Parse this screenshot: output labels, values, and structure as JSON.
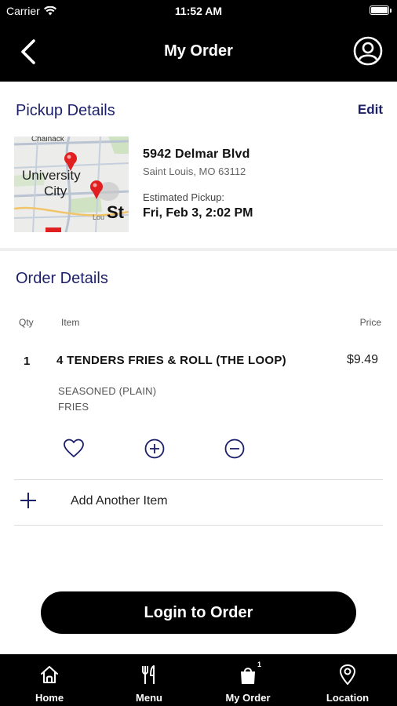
{
  "status_bar": {
    "carrier": "Carrier",
    "time": "11:52 AM"
  },
  "header": {
    "title": "My Order",
    "back_icon": "chevron-left-icon",
    "profile_icon": "user-circle-icon"
  },
  "pickup": {
    "title": "Pickup Details",
    "edit_label": "Edit",
    "map": {
      "labels": [
        "Chainack",
        "University",
        "City",
        "St",
        "Lou"
      ]
    },
    "street": "5942 Delmar Blvd",
    "city_line": "Saint Louis, MO 63112",
    "estimated_label": "Estimated Pickup:",
    "estimated_value": "Fri, Feb 3, 2:02 PM"
  },
  "order": {
    "title": "Order Details",
    "columns": {
      "qty": "Qty",
      "item": "Item",
      "price": "Price"
    },
    "items": [
      {
        "qty": "1",
        "name": "4 TENDERS FRIES & ROLL (THE LOOP)",
        "modifiers": [
          "SEASONED (PLAIN)",
          "FRIES"
        ],
        "price": "$9.49"
      }
    ],
    "actions": [
      "heart-icon",
      "plus-circle-icon",
      "minus-circle-icon"
    ],
    "add_item_label": "Add Another Item"
  },
  "login_button": "Login to Order",
  "tabs": [
    {
      "label": "Home",
      "icon": "home-icon"
    },
    {
      "label": "Menu",
      "icon": "utensils-icon"
    },
    {
      "label": "My Order",
      "icon": "bag-icon",
      "badge": "1"
    },
    {
      "label": "Location",
      "icon": "location-pin-icon"
    }
  ],
  "colors": {
    "brand_navy": "#1c1f6a",
    "bar": "#000000",
    "map_pin": "#e02020"
  }
}
